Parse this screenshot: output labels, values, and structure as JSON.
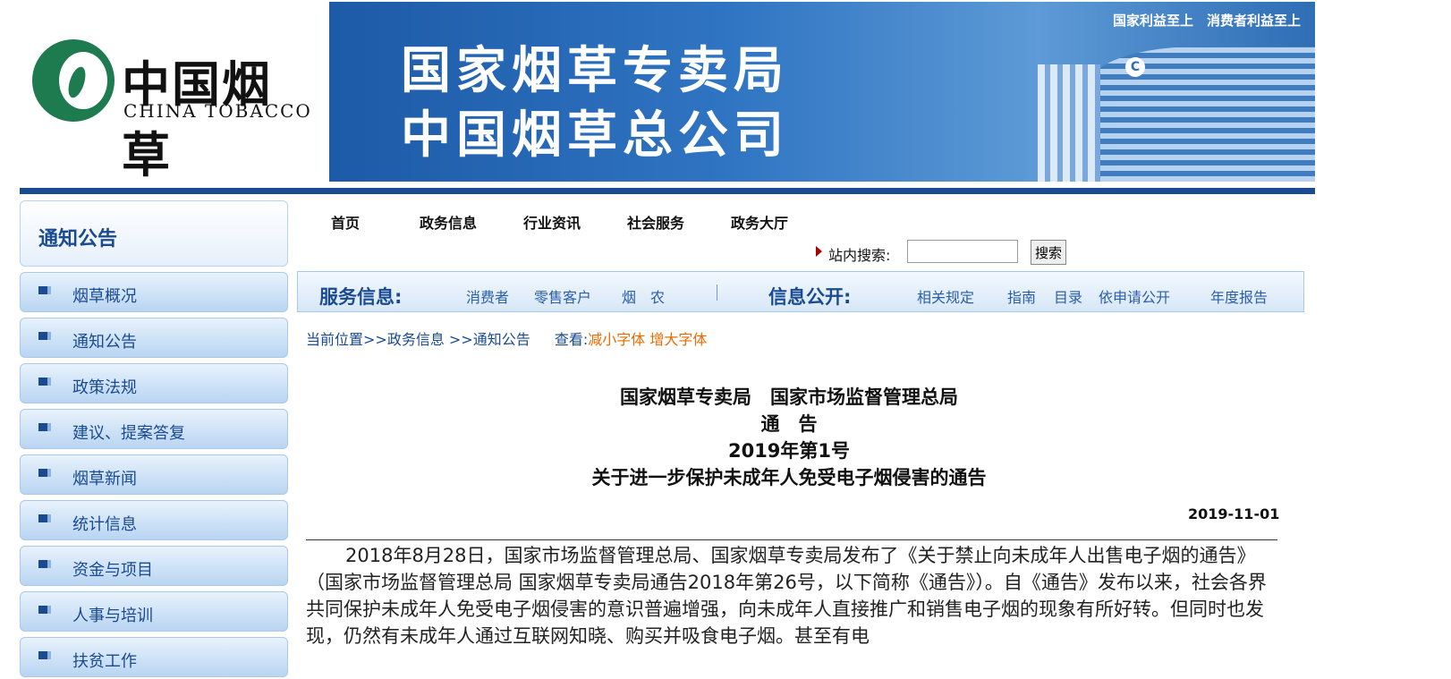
{
  "logo": {
    "cn": "中国烟草",
    "en": "CHINA TOBACCO"
  },
  "banner": {
    "line1": "国家烟草专卖局",
    "line2": "中国烟草总公司",
    "slogan": "国家利益至上　消费者利益至上",
    "building_logo": "C"
  },
  "sidebar": {
    "heading": "通知公告",
    "items": [
      {
        "label": "烟草概况"
      },
      {
        "label": "通知公告"
      },
      {
        "label": "政策法规"
      },
      {
        "label": "建议、提案答复"
      },
      {
        "label": "烟草新闻"
      },
      {
        "label": "统计信息"
      },
      {
        "label": "资金与项目"
      },
      {
        "label": "人事与培训"
      },
      {
        "label": "扶贫工作"
      }
    ]
  },
  "nav": {
    "items": [
      {
        "label": "首页"
      },
      {
        "label": "政务信息"
      },
      {
        "label": "行业资讯"
      },
      {
        "label": "社会服务"
      },
      {
        "label": "政务大厅"
      }
    ]
  },
  "search": {
    "label": "站内搜索:",
    "value": "",
    "button": "搜索"
  },
  "service_bar": {
    "service_heading": "服务信息:",
    "service_links": [
      "消费者",
      "零售客户",
      "烟　农"
    ],
    "open_heading": "信息公开:",
    "open_links": [
      "相关规定",
      "指南",
      "目录",
      "依申请公开",
      "年度报告"
    ]
  },
  "breadcrumb": {
    "path": "当前位置>>政务信息 >>通知公告",
    "view_label": "查看:",
    "smaller": "减小字体",
    "larger": "增大字体"
  },
  "article": {
    "title_line1": "国家烟草专卖局　国家市场监督管理总局",
    "title_line2": "通　告",
    "title_line3": "2019年第1号",
    "title_line4": "关于进一步保护未成年人免受电子烟侵害的通告",
    "date": "2019-11-01",
    "body": "2018年8月28日，国家市场监督管理总局、国家烟草专卖局发布了《关于禁止向未成年人出售电子烟的通告》（国家市场监督管理总局 国家烟草专卖局通告2018年第26号，以下简称《通告》）。自《通告》发布以来，社会各界共同保护未成年人免受电子烟侵害的意识普遍增强，向未成年人直接推广和销售电子烟的现象有所好转。但同时也发现，仍然有未成年人通过互联网知晓、购买并吸食电子烟。甚至有电"
  },
  "colors": {
    "brand_blue": "#1a4a90",
    "brand_green": "#1e7a4f",
    "accent_orange": "#e86a00",
    "link_blue": "#2b5ea8"
  }
}
